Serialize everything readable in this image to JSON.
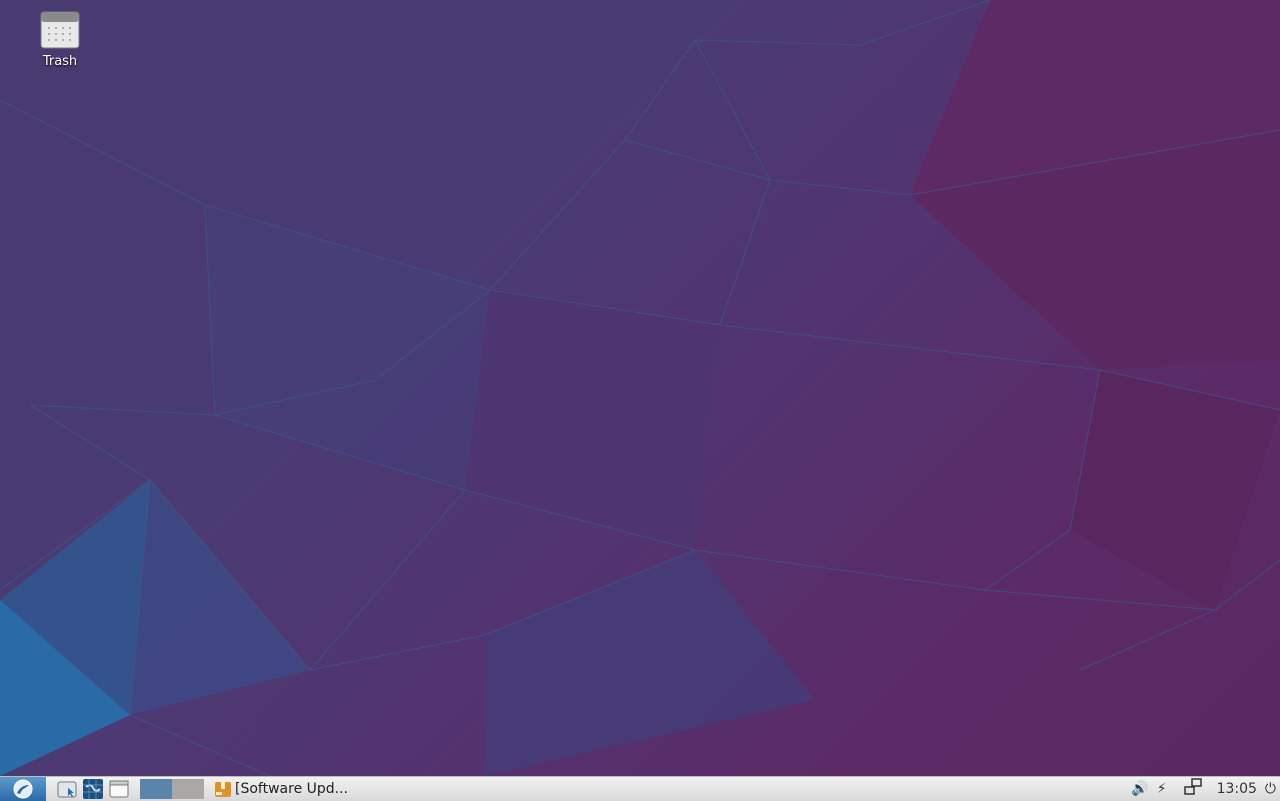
{
  "desktop": {
    "icons": [
      {
        "label": "Trash",
        "icon": "trash-icon"
      }
    ]
  },
  "taskbar": {
    "menu_icon": "lubuntu-logo-icon",
    "launchers": [
      {
        "name": "file-manager-launcher",
        "icon": "folder-icon"
      },
      {
        "name": "web-browser-launcher",
        "icon": "globe-icon"
      },
      {
        "name": "show-desktop-launcher",
        "icon": "window-icon"
      }
    ],
    "pager": {
      "workspaces": 2,
      "active": 1,
      "colors": {
        "active": "#5b84ad",
        "inactive": "#aaa7a4"
      }
    },
    "tasks": [
      {
        "label": "[Software Upd...",
        "icon": "package-icon"
      }
    ],
    "tray": {
      "volume_icon": "volume-icon",
      "power_icon": "battery-charging-icon",
      "network_icon": "network-icon",
      "clock": "13:05",
      "shutdown_icon": "power-icon"
    }
  }
}
